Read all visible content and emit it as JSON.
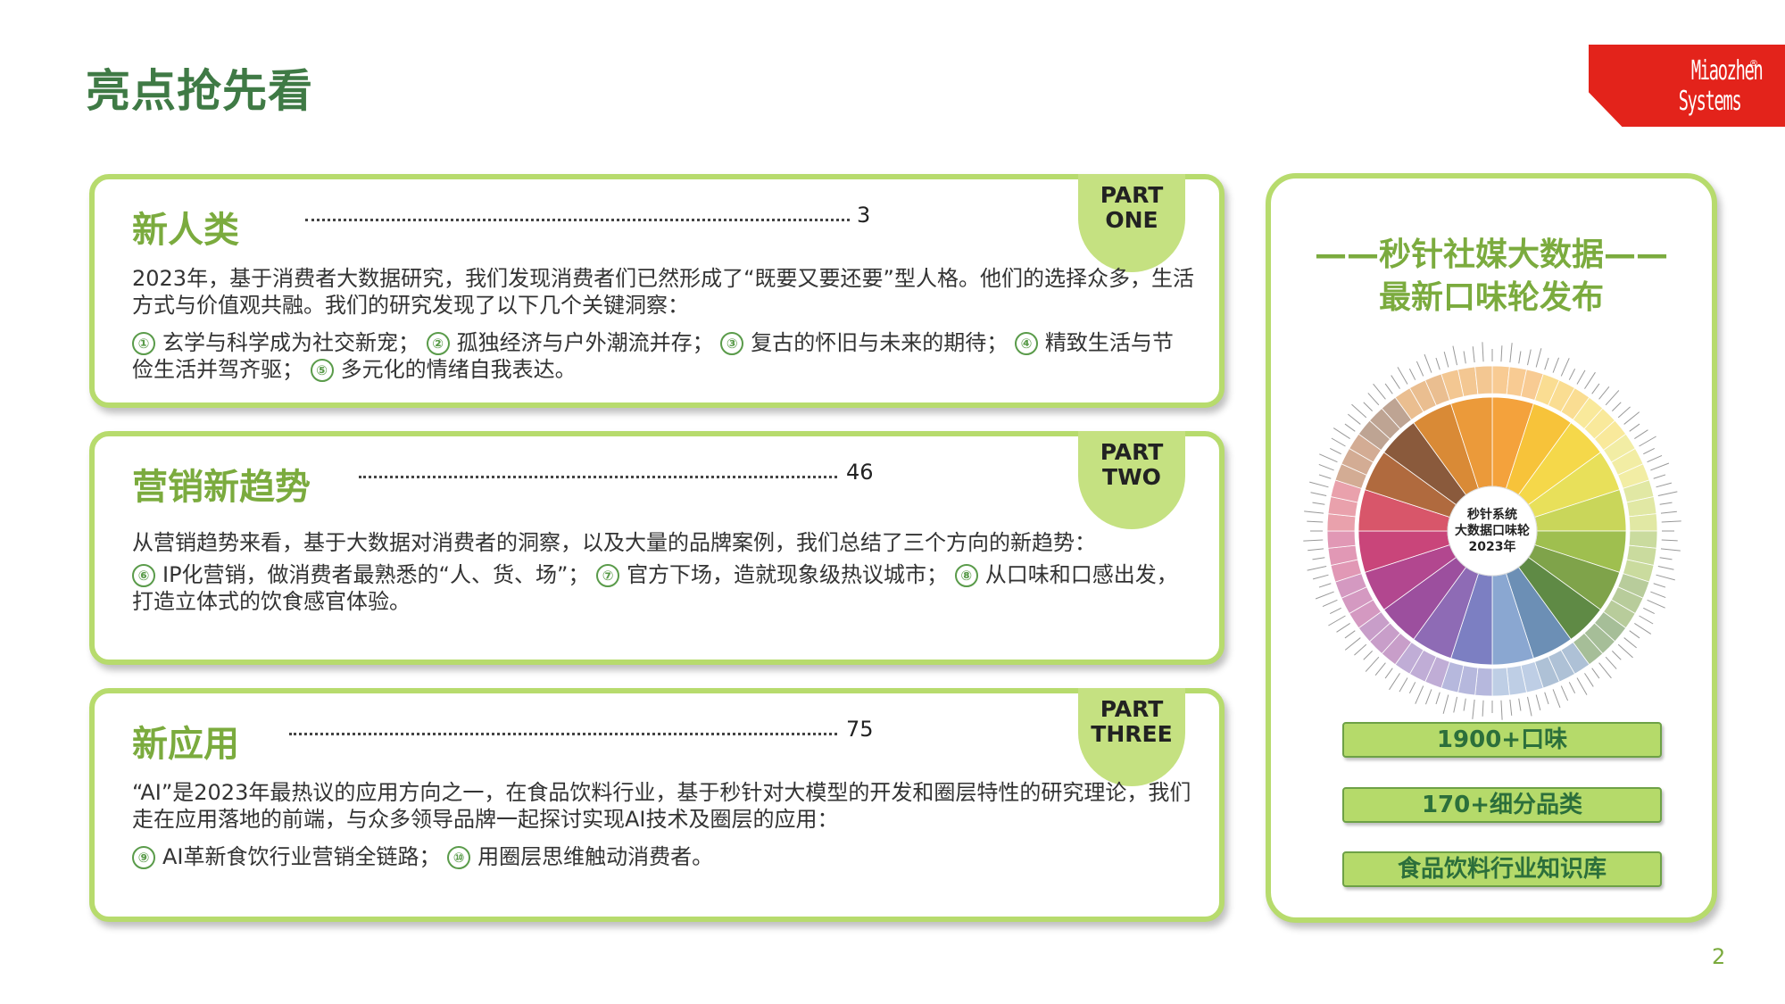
{
  "page": {
    "title": "亮点抢先看",
    "slide_number": "2"
  },
  "logo": {
    "line1": "Miaozhen",
    "line2": "Systems",
    "reg": "®"
  },
  "sections": [
    {
      "title": "新人类",
      "page": "3",
      "part_line1": "PART",
      "part_line2": "ONE",
      "intro": "2023年，基于消费者大数据研究，我们发现消费者们已然形成了“既要又要还要”型人格。他们的选择众多，生活方式与价值观共融。我们的研究发现了以下几个关键洞察：",
      "points": [
        {
          "num": "①",
          "text": "玄学与科学成为社交新宠；"
        },
        {
          "num": "②",
          "text": "孤独经济与户外潮流并存；"
        },
        {
          "num": "③",
          "text": "复古的怀旧与未来的期待；"
        },
        {
          "num": "④",
          "text": "精致生活与节俭生活并驾齐驱；"
        },
        {
          "num": "⑤",
          "text": "多元化的情绪自我表达。"
        }
      ]
    },
    {
      "title": "营销新趋势",
      "page": "46",
      "part_line1": "PART",
      "part_line2": "TWO",
      "intro": "从营销趋势来看，基于大数据对消费者的洞察，以及大量的品牌案例，我们总结了三个方向的新趋势：",
      "points": [
        {
          "num": "⑥",
          "text": "IP化营销，做消费者最熟悉的“人、货、场”；"
        },
        {
          "num": "⑦",
          "text": "官方下场，造就现象级热议城市；"
        },
        {
          "num": "⑧",
          "text": "从口味和口感出发，打造立体式的饮食感官体验。"
        }
      ]
    },
    {
      "title": "新应用",
      "page": "75",
      "part_line1": "PART",
      "part_line2": "THREE",
      "intro": "“AI”是2023年最热议的应用方向之一，在食品饮料行业，基于秒针对大模型的开发和圈层特性的研究理论，我们走在应用落地的前端，与众多领导品牌一起探讨实现AI技术及圈层的应用：",
      "points": [
        {
          "num": "⑨",
          "text": "AI革新食饮行业营销全链路；"
        },
        {
          "num": "⑩",
          "text": "用圈层思维触动消费者。"
        }
      ]
    }
  ],
  "right_panel": {
    "title_line1": "——秒针社媒大数据——",
    "title_line2": "最新口味轮发布",
    "wheel_center_line1": "秒针系统",
    "wheel_center_line2": "大数据口味轮",
    "wheel_center_line3": "2023年",
    "stats": [
      "1900+口味",
      "170+细分品类",
      "食品饮料行业知识库"
    ]
  },
  "colors": {
    "title_green": "#3f7a45",
    "accent_green": "#7bab3e",
    "card_border": "#b7db6d",
    "logo_red": "#e3231b"
  }
}
